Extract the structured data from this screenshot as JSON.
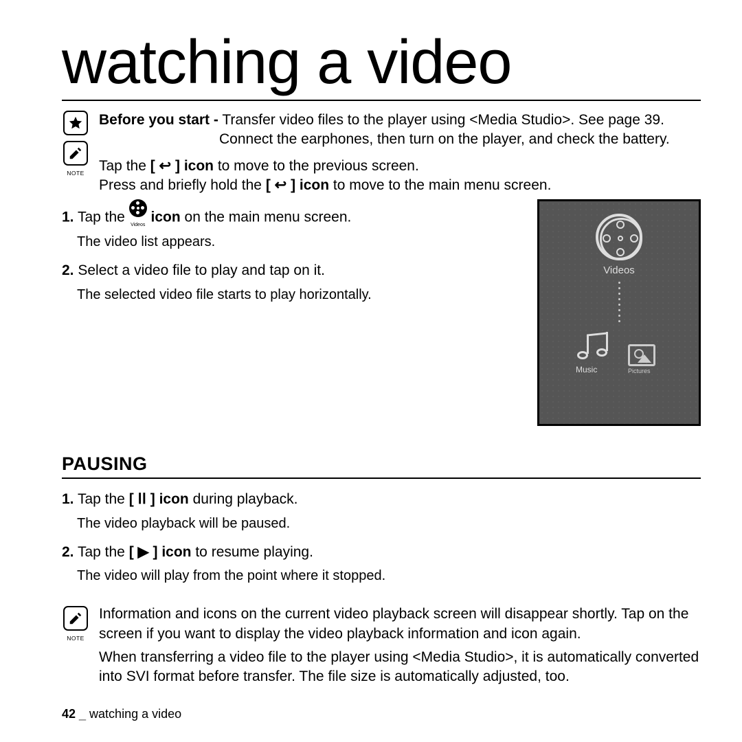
{
  "title": "watching a video",
  "before_you_start_label": "Before you start -",
  "before_you_start_text": " Transfer video files to the player using <Media Studio>. See page 39.",
  "before_line2": "Connect the earphones, then turn on the player, and check the battery.",
  "note_label": "NOTE",
  "note_line1_a": "Tap the ",
  "note_line1_b": " to move to the previous screen.",
  "note_icon_label1": "[ ↩ ] icon",
  "note_line2_a": "Press and briefly hold the ",
  "note_line2_b": " to move to the main menu screen.",
  "note_icon_label2": "[ ↩ ] icon",
  "step1_no": "1.",
  "step1_a": " Tap the ",
  "step1_b": " icon",
  "step1_c": " on the main menu screen.",
  "reel_label": "Videos",
  "step1_sub": "The video list appears.",
  "step2_no": "2.",
  "step2_text": " Select a video file to play and tap on it.",
  "step2_sub": "The selected video file starts to play horizontally.",
  "screenshot": {
    "videos_label": "Videos",
    "music_label": "Music",
    "pictures_label": "Pictures"
  },
  "pausing_title": "PAUSING",
  "p1_no": "1.",
  "p1_a": " Tap the ",
  "p1_icon": "[ ⅠⅠ ] icon",
  "p1_b": " during playback.",
  "p1_sub": "The video playback will be paused.",
  "p2_no": "2.",
  "p2_a": " Tap the ",
  "p2_icon": "[ ▶ ] icon",
  "p2_b": " to resume playing.",
  "p2_sub": "The video will play from the point where it stopped.",
  "footnote1": "Information and icons on the current video playback screen will disappear shortly. Tap on the screen if you want to display the video playback information and icon again.",
  "footnote2": "When transferring a video file to the player using <Media Studio>, it is automatically converted into SVI format before transfer. The file size is automatically adjusted, too.",
  "footer_page": "42",
  "footer_sep": " _ ",
  "footer_title": "watching a video"
}
